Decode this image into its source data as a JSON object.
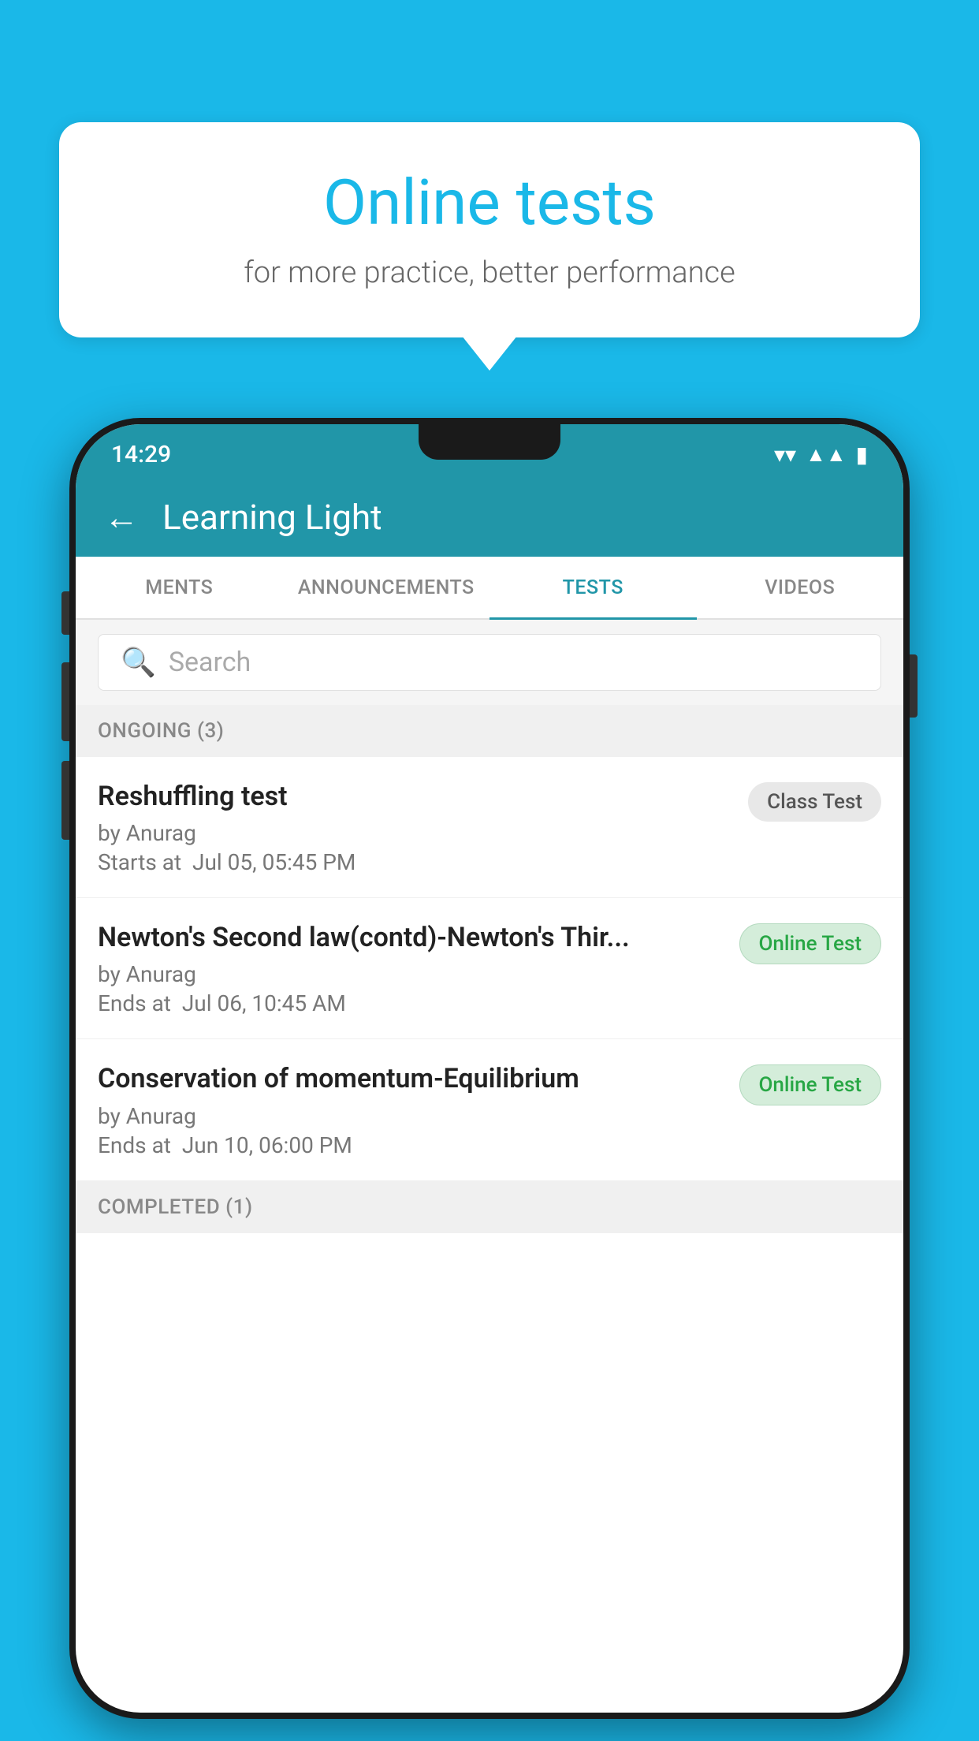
{
  "background": {
    "color": "#1ab8e8"
  },
  "speech_bubble": {
    "title": "Online tests",
    "subtitle": "for more practice, better performance"
  },
  "phone": {
    "status_bar": {
      "time": "14:29",
      "wifi": "▼",
      "signal": "▲",
      "battery": "▮"
    },
    "header": {
      "back_icon": "←",
      "title": "Learning Light"
    },
    "tabs": [
      {
        "label": "MENTS",
        "active": false
      },
      {
        "label": "ANNOUNCEMENTS",
        "active": false
      },
      {
        "label": "TESTS",
        "active": true
      },
      {
        "label": "VIDEOS",
        "active": false
      }
    ],
    "search": {
      "placeholder": "Search",
      "icon": "🔍"
    },
    "ongoing_section": {
      "label": "ONGOING (3)"
    },
    "test_items": [
      {
        "title": "Reshuffling test",
        "author": "by Anurag",
        "time_label": "Starts at",
        "time": "Jul 05, 05:45 PM",
        "badge": "Class Test",
        "badge_type": "class"
      },
      {
        "title": "Newton's Second law(contd)-Newton's Thir...",
        "author": "by Anurag",
        "time_label": "Ends at",
        "time": "Jul 06, 10:45 AM",
        "badge": "Online Test",
        "badge_type": "online"
      },
      {
        "title": "Conservation of momentum-Equilibrium",
        "author": "by Anurag",
        "time_label": "Ends at",
        "time": "Jun 10, 06:00 PM",
        "badge": "Online Test",
        "badge_type": "online"
      }
    ],
    "completed_section": {
      "label": "COMPLETED (1)"
    }
  }
}
